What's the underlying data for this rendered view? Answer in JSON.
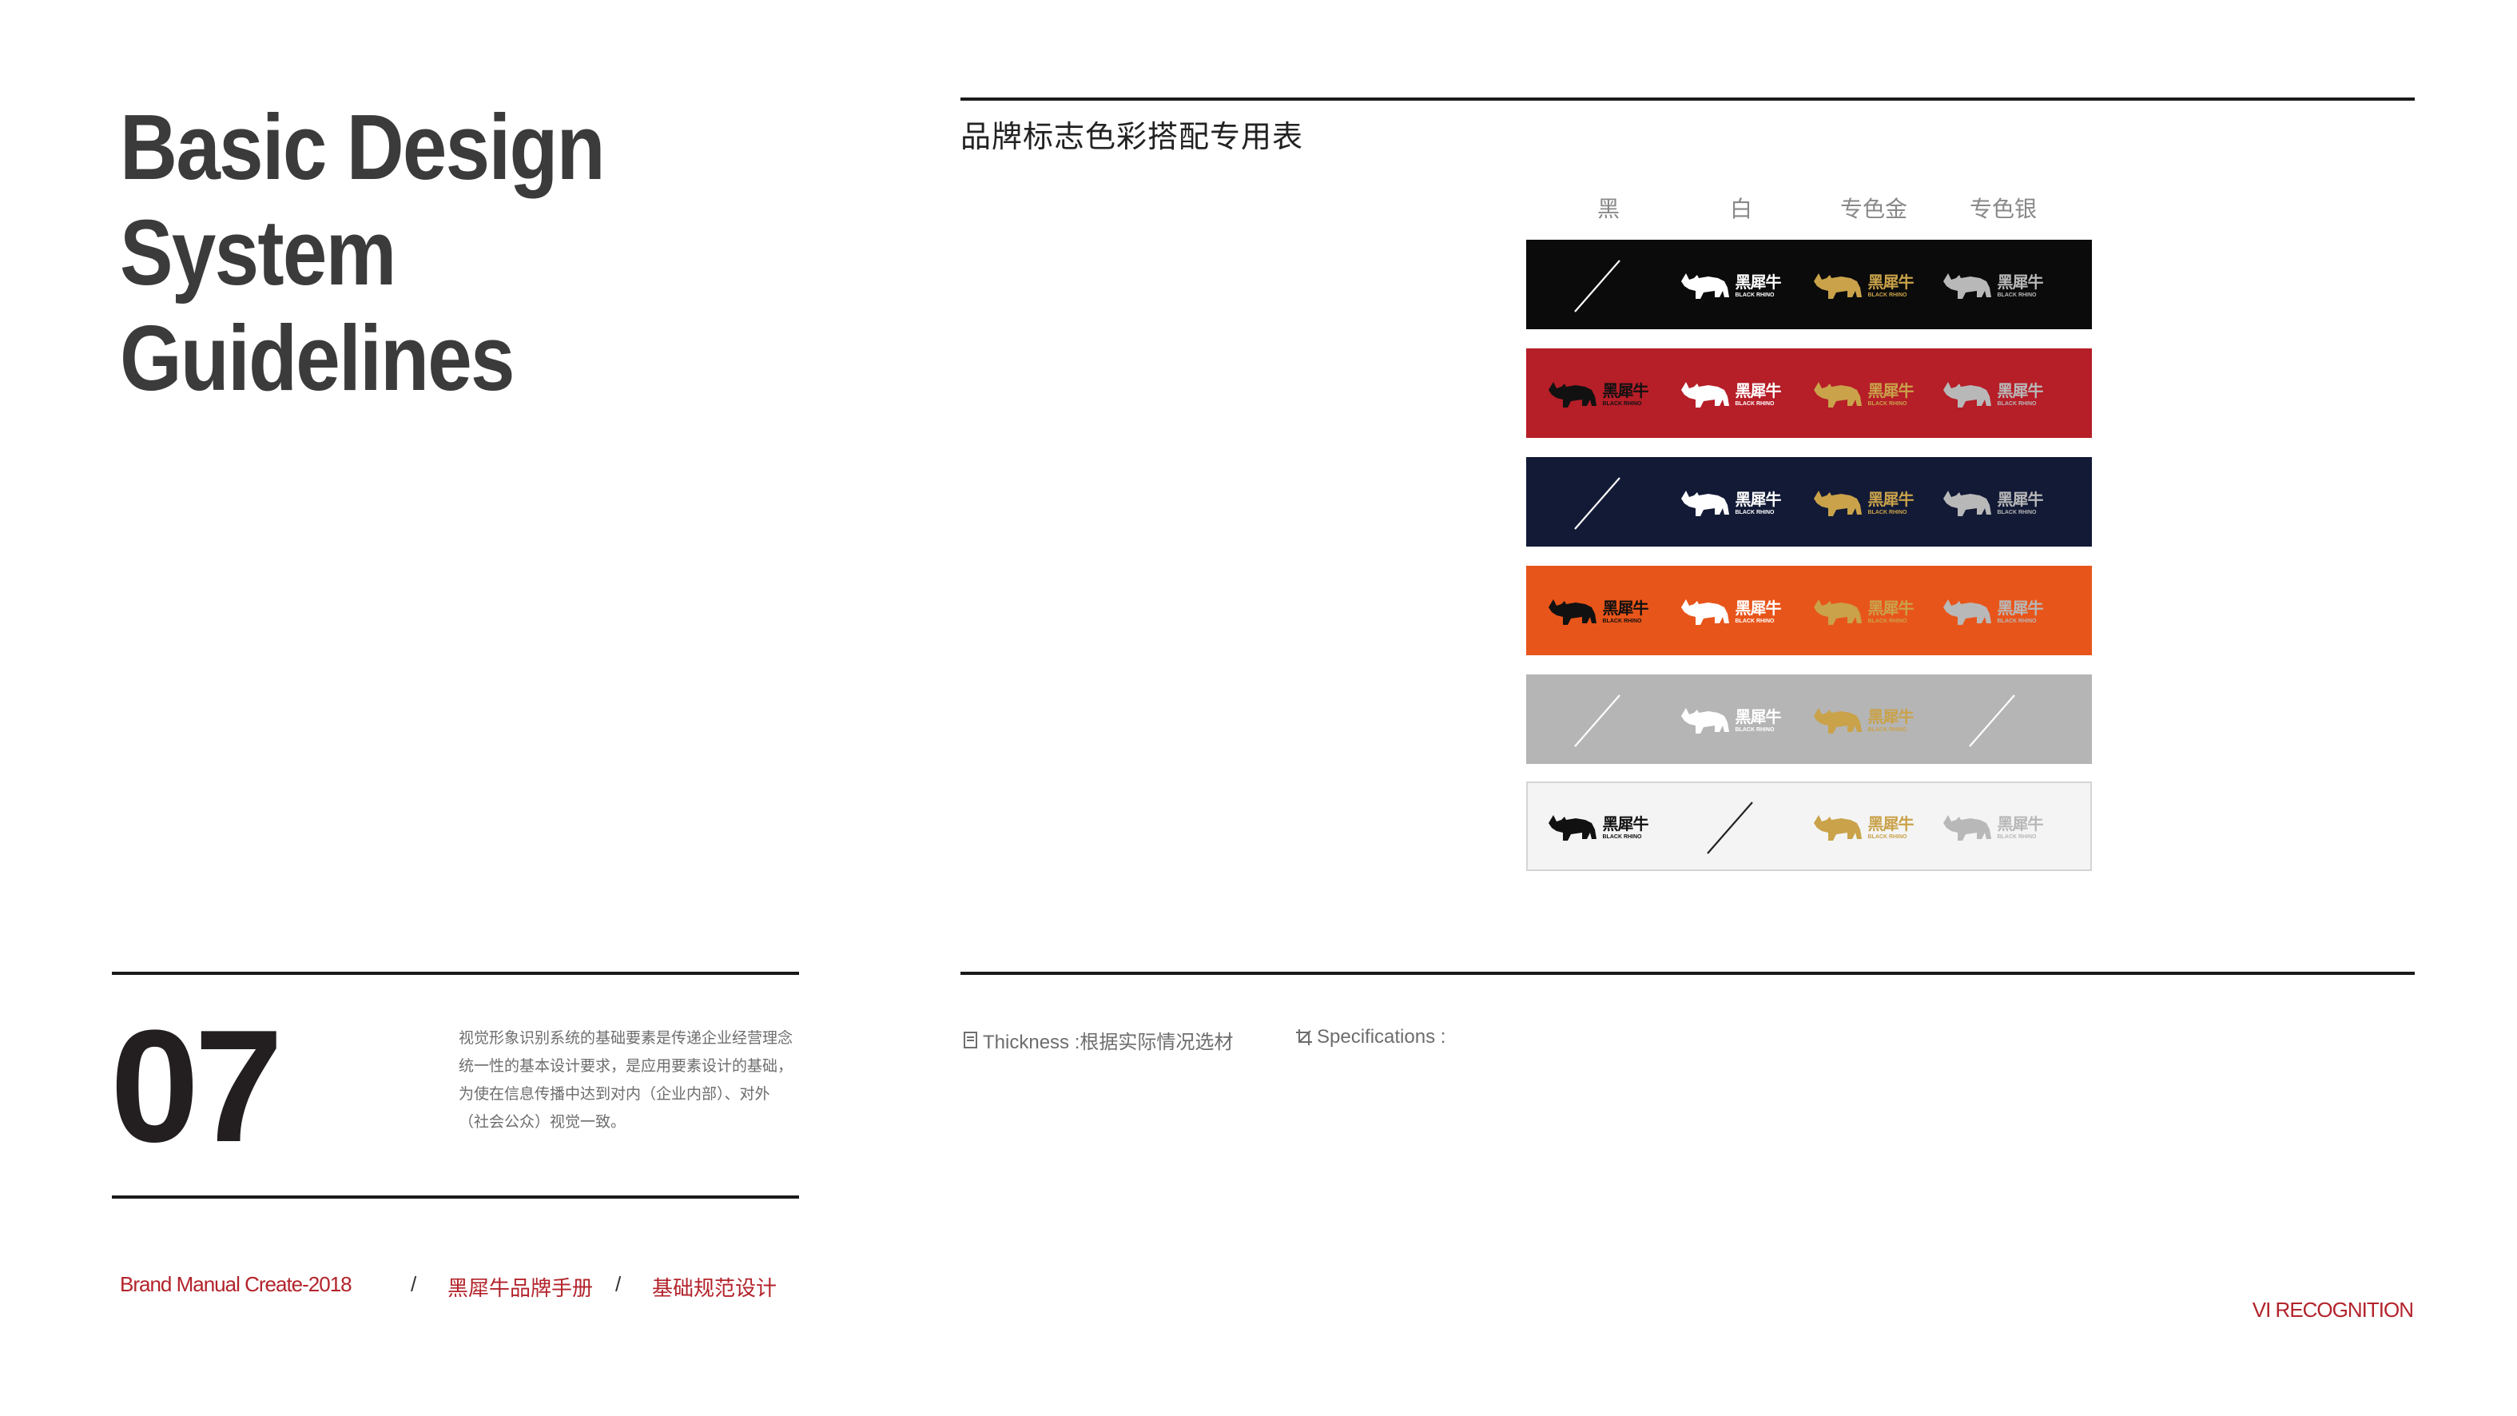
{
  "page": {
    "title_lines": [
      "Basic Design",
      "System",
      "Guidelines"
    ],
    "section_title": "品牌标志色彩搭配专用表",
    "page_number": "07",
    "description": "视觉形象识别系统的基础要素是传递企业经营理念统一性的基本设计要求，是应用要素设计的基础，为使在信息传播中达到对内（企业内部）、对外（社会公众）视觉一致。"
  },
  "columns": [
    "黑",
    "白",
    "专色金",
    "专色银"
  ],
  "logo": {
    "cn": "黑犀牛",
    "en": "BLACK RHINO"
  },
  "colors": {
    "black": "#111111",
    "white": "#ffffff",
    "gold": "#c9a24a",
    "silver": "#b8b8b8",
    "rule": "#1a1a1a",
    "accent": "#b3232b"
  },
  "rows": [
    {
      "background": "#0b0b0b",
      "border": "#0b0b0b",
      "cells": [
        "none",
        "white",
        "gold",
        "silver"
      ]
    },
    {
      "background": "#b61e28",
      "border": "#b61e28",
      "cells": [
        "black",
        "white",
        "gold",
        "silver"
      ]
    },
    {
      "background": "#121a36",
      "border": "#121a36",
      "cells": [
        "none",
        "white",
        "gold",
        "silver"
      ]
    },
    {
      "background": "#e8551a",
      "border": "#e8551a",
      "cells": [
        "black",
        "white",
        "gold",
        "silver"
      ]
    },
    {
      "background": "#b5b5b5",
      "border": "#b5b5b5",
      "cells": [
        "none",
        "white",
        "gold",
        "none"
      ]
    },
    {
      "background": "#f4f4f4",
      "border": "#d4d4d4",
      "cells": [
        "black",
        "none",
        "gold",
        "silver"
      ]
    }
  ],
  "specs": {
    "thickness_icon": "document-icon",
    "thickness_label": "Thickness :根据实际情况选材",
    "spec_icon": "crop-icon",
    "spec_label": "Specifications :"
  },
  "footer": {
    "brand": "Brand Manual Create-2018",
    "sep1": "/",
    "manual": "黑犀牛品牌手册",
    "sep2": "/",
    "section": "基础规范设计",
    "vi": "VI RECOGNITION"
  }
}
